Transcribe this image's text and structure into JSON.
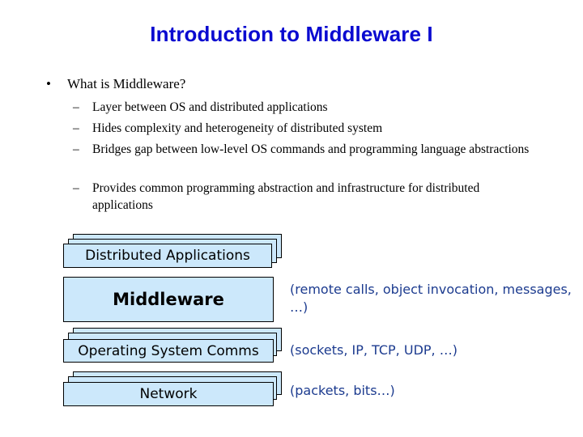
{
  "slide": {
    "title": "Introduction to Middleware I",
    "bullet": {
      "symbol": "•",
      "text": "What is Middleware?",
      "sub_items": [
        {
          "symbol": "–",
          "text": "Layer between OS and distributed applications"
        },
        {
          "symbol": "–",
          "text": "Hides complexity and heterogeneity of distributed system"
        },
        {
          "symbol": "–",
          "text": "Bridges gap between low-level OS commands and programming language abstractions"
        },
        {
          "symbol": "–",
          "text": "Provides common programming abstraction and infrastructure for distributed applications"
        }
      ]
    }
  },
  "diagram": {
    "layers": [
      {
        "label": "Distributed Applications",
        "note": ""
      },
      {
        "label": "Middleware",
        "note": "(remote calls, object invocation, messages, …)"
      },
      {
        "label": "Operating System Comms",
        "note": "(sockets, IP, TCP, UDP, …)"
      },
      {
        "label": "Network",
        "note": "(packets, bits…)"
      }
    ],
    "colors": {
      "box_fill": "#cce8fb",
      "title": "#0a0ad0",
      "note_text": "#1c3b8f"
    }
  }
}
